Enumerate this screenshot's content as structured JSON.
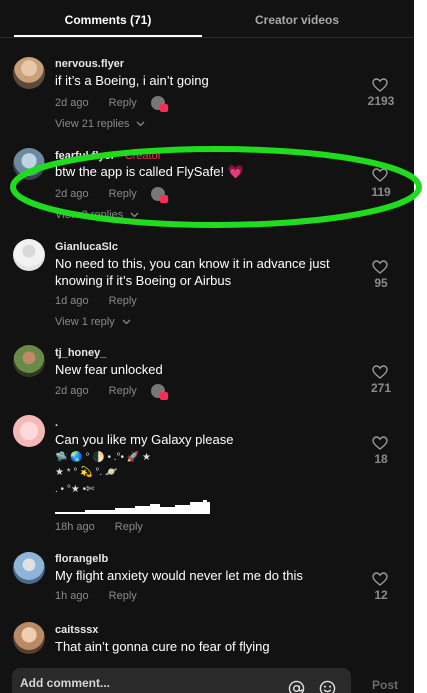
{
  "tabs": [
    {
      "label": "Comments (71)"
    },
    {
      "label": "Creator videos"
    }
  ],
  "comments": [
    {
      "username": "nervous.flyer",
      "text": "if it’s a Boeing, i ain’t going",
      "time": "2d ago",
      "reply": "Reply",
      "likes": "2193",
      "view_replies": "View 21 replies"
    },
    {
      "username": "fearful.flyer",
      "creator_tag": " · Creator",
      "text": "btw the app is called FlySafe! 💗",
      "time": "2d ago",
      "reply": "Reply",
      "likes": "119",
      "view_replies": "View 2 replies"
    },
    {
      "username": "GianlucaSlc",
      "text_lines": [
        "No need to this, you can know it in advance just",
        "knowing if it’s Boeing or Airbus"
      ],
      "time": "1d ago",
      "reply": "Reply",
      "likes": "95",
      "view_replies": "View 1 reply"
    },
    {
      "username": "tj_honey_",
      "text": "New fear unlocked",
      "time": "2d ago",
      "reply": "Reply",
      "likes": "271"
    },
    {
      "username": ".",
      "text": "Can you like my Galaxy please",
      "emoji_lines": [
        "🛸          🌏         °     🌓      •    .°•          🚀    ★",
        "     ★      *          °              💫      °.          🪐",
        "  .                 •     °★     •✄"
      ],
      "time": "18h ago",
      "reply": "Reply",
      "likes": "18"
    },
    {
      "username": "florangelb",
      "text": "My flight anxiety would never let me do this",
      "time": "1h ago",
      "reply": "Reply",
      "likes": "12"
    },
    {
      "username": "caitsssx",
      "text": "That ain’t gonna cure no fear of flying"
    }
  ],
  "composer": {
    "placeholder": "Add comment...",
    "post_label": "Post"
  },
  "colors": {
    "accent": "#fe2c55",
    "highlight": "#1fdc1f",
    "background": "#121212"
  },
  "icons": [
    "heart-icon",
    "chevron-down-icon",
    "at-icon",
    "emoji-icon"
  ]
}
